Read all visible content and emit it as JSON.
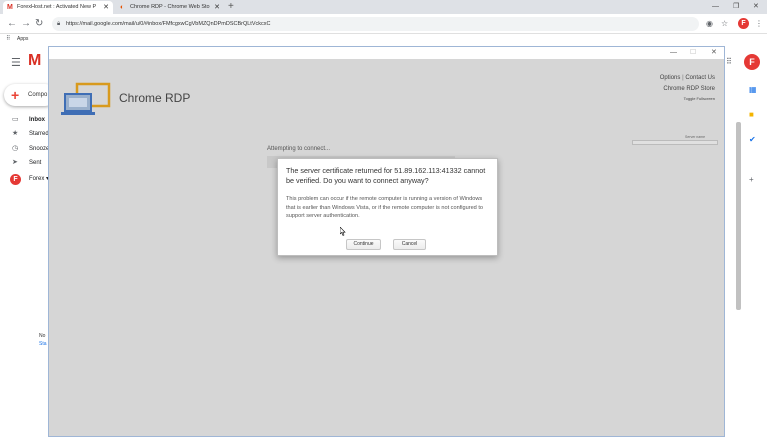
{
  "browser": {
    "tabs": [
      {
        "favicon": "M",
        "title": "ForexHost.net : Activated New P",
        "active": true
      },
      {
        "favicon": "◐",
        "title": "Chrome RDP - Chrome Web Sto",
        "active": false
      }
    ],
    "url": "https://mail.google.com/mail/u/0/#inbox/FMfcgxwCgVbMZQnDPmDSCBrQLtVckcxC",
    "bookmarks_label": "Apps"
  },
  "gmail": {
    "compose_label": "Compo",
    "nav": [
      {
        "icon": "inbox-icon",
        "label": "Inbox"
      },
      {
        "icon": "star-icon",
        "label": "Starred"
      },
      {
        "icon": "clock-icon",
        "label": "Snooze"
      },
      {
        "icon": "send-icon",
        "label": "Sent"
      },
      {
        "icon": "avatar-icon",
        "label": "Forex ▾"
      }
    ],
    "side_note_1": "No",
    "side_note_2": "Sta"
  },
  "rdp": {
    "app_title": "Chrome RDP",
    "options_link": "Options",
    "separator": "|",
    "contact_link": "Contact Us",
    "store_link": "Chrome RDP Store",
    "toggle_fullscreen": "Toggle Fullscreen",
    "field_label": "Server name",
    "attempting": "Attempting to connect..."
  },
  "dialog": {
    "title": "The server certificate returned for 51.89.162.113:41332 cannot be verified. Do you want to connect anyway?",
    "body": "This problem can occur if the remote computer is running a version of Windows that is earlier than Windows Vista, or if the remote computer is not configured to support server authentication.",
    "continue_label": "Continue",
    "cancel_label": "Cancel"
  }
}
